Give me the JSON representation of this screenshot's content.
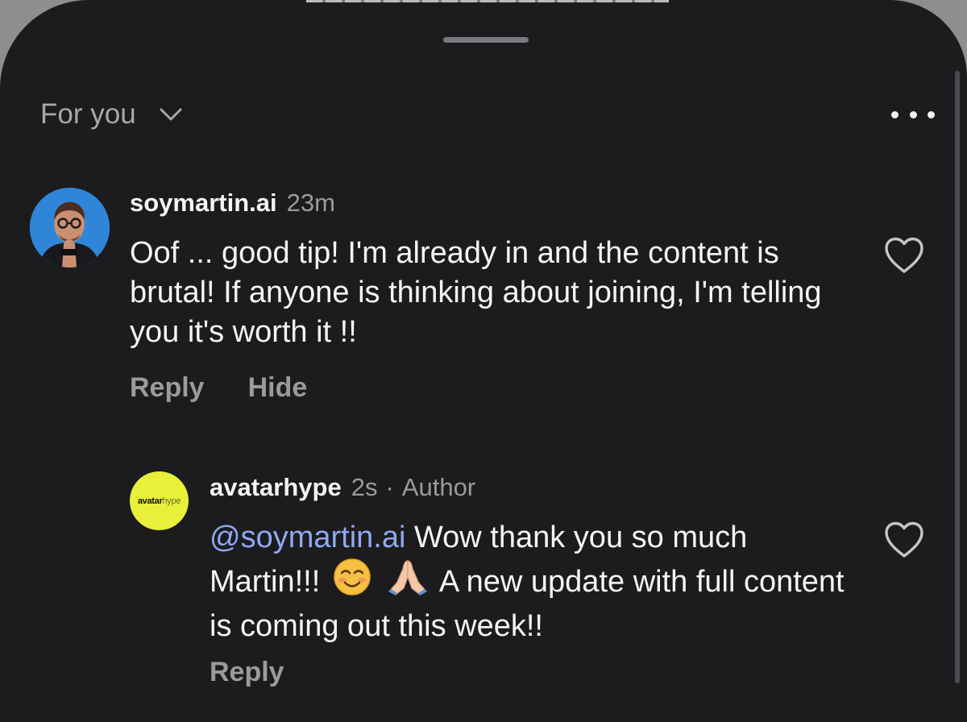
{
  "header": {
    "filter_label": "For you",
    "filter_icon": "chevron-down-icon",
    "more_icon": "more-horizontal-icon"
  },
  "comments": [
    {
      "username": "soymartin.ai",
      "time": "23m",
      "avatar_icon": "user-avatar-photo",
      "text": "Oof ... good tip! I'm already in and the content is brutal! If anyone is thinking about joining, I'm telling you it's worth it !!",
      "actions": [
        "Reply",
        "Hide"
      ],
      "like_icon": "heart-icon"
    },
    {
      "username": "avatarhype",
      "time": "2s",
      "separator": "·",
      "badge": "Author",
      "avatar_logo_bold": "avatar",
      "avatar_logo_light": "hype",
      "mention": "@soymartin.ai",
      "text_part1": " Wow thank you so much Martin!!!",
      "emojis": [
        "smiling-face-emoji",
        "folded-hands-emoji"
      ],
      "text_part2": " A new update with full content is coming out this week!!",
      "actions": [
        "Reply"
      ],
      "like_icon": "heart-icon"
    }
  ],
  "colors": {
    "background": "#1c1c1e",
    "text_primary": "#f5f5f5",
    "text_secondary": "#9b9b9e",
    "mention": "#8fa8f2",
    "avatarhype_yellow": "#e8f03a",
    "avatar_blue": "#2f86d8"
  }
}
